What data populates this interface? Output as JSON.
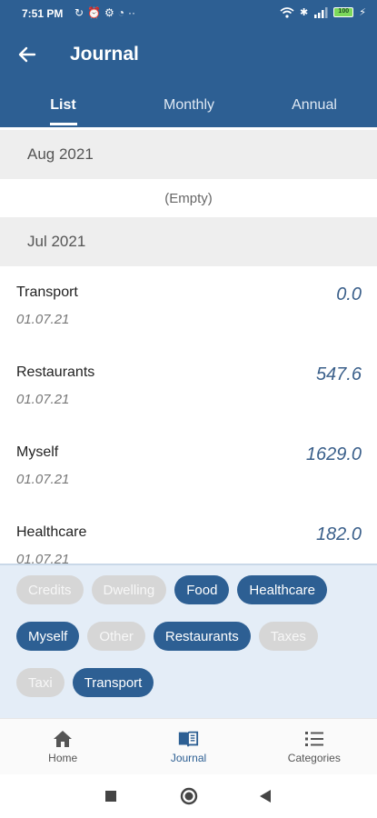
{
  "status_bar": {
    "time": "7:51 PM",
    "battery": "100"
  },
  "app_bar": {
    "title": "Journal"
  },
  "tabs": [
    {
      "label": "List",
      "active": true
    },
    {
      "label": "Monthly",
      "active": false
    },
    {
      "label": "Annual",
      "active": false
    }
  ],
  "journal": {
    "months": [
      {
        "label": "Aug 2021",
        "empty_text": "(Empty)",
        "entries": []
      },
      {
        "label": "Jul 2021",
        "entries": [
          {
            "category": "Transport",
            "date": "01.07.21",
            "amount": "0.0"
          },
          {
            "category": "Restaurants",
            "date": "01.07.21",
            "amount": "547.6"
          },
          {
            "category": "Myself",
            "date": "01.07.21",
            "amount": "1629.0"
          },
          {
            "category": "Healthcare",
            "date": "01.07.21",
            "amount": "182.0"
          }
        ]
      }
    ]
  },
  "filters": [
    {
      "label": "Credits",
      "selected": false
    },
    {
      "label": "Dwelling",
      "selected": false
    },
    {
      "label": "Food",
      "selected": true
    },
    {
      "label": "Healthcare",
      "selected": true
    },
    {
      "label": "Myself",
      "selected": true
    },
    {
      "label": "Other",
      "selected": false
    },
    {
      "label": "Restaurants",
      "selected": true
    },
    {
      "label": "Taxes",
      "selected": false
    },
    {
      "label": "Taxi",
      "selected": false
    },
    {
      "label": "Transport",
      "selected": true
    }
  ],
  "bottom_nav": [
    {
      "label": "Home",
      "icon": "home-icon",
      "active": false
    },
    {
      "label": "Journal",
      "icon": "book-icon",
      "active": true
    },
    {
      "label": "Categories",
      "icon": "list-icon",
      "active": false
    }
  ],
  "colors": {
    "primary": "#2d5f93",
    "amount": "#3a5f8a",
    "chip_off": "#d6d6d6",
    "panel": "#e4edf7"
  }
}
